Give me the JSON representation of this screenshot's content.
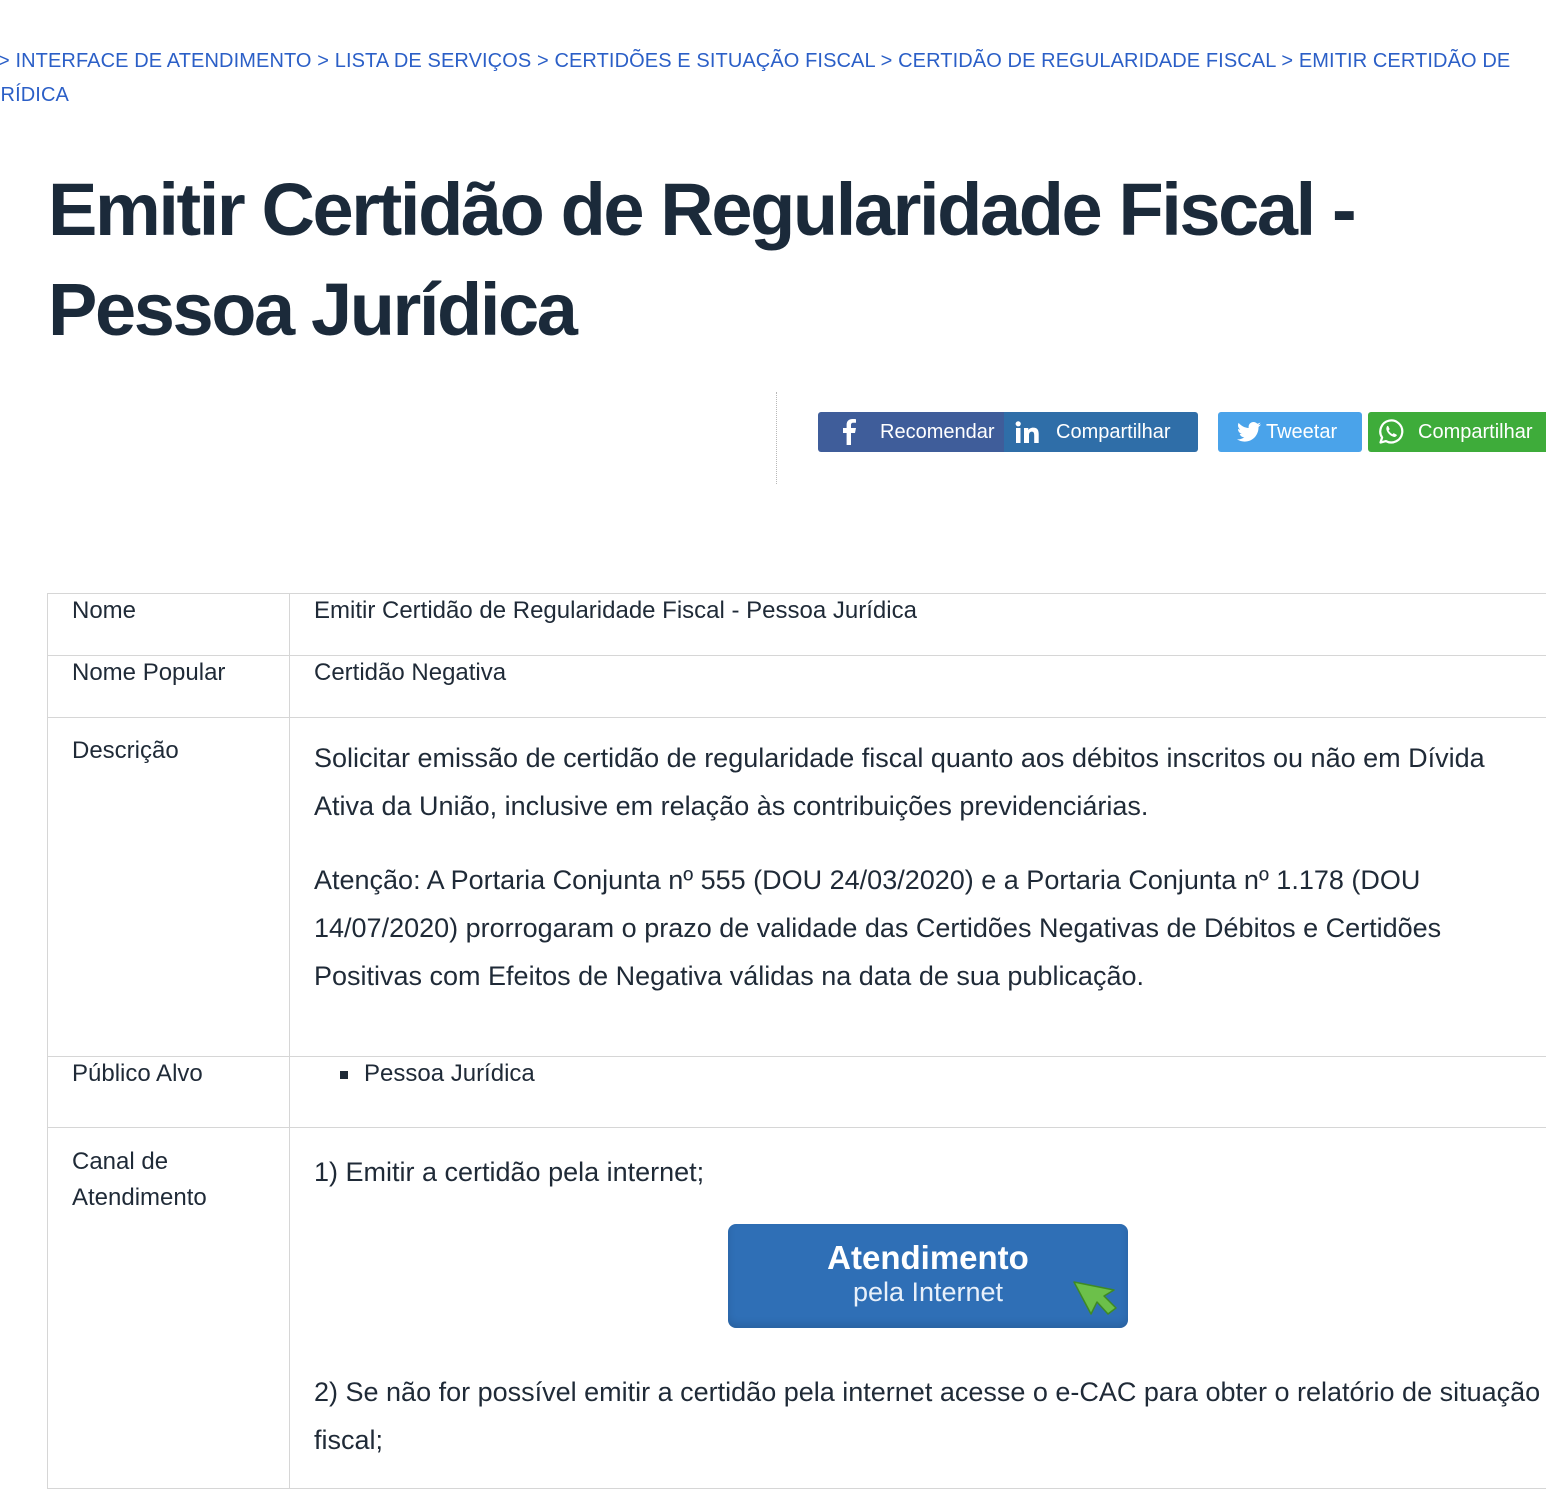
{
  "breadcrumb": {
    "items": [
      "INTERFACE DE ATENDIMENTO",
      "LISTA DE SERVIÇOS",
      "CERTIDÕES E SITUAÇÃO FISCAL",
      "CERTIDÃO DE REGULARIDADE FISCAL",
      "EMITIR CERTIDÃO DE",
      "URÍDICA"
    ],
    "separator": ">"
  },
  "page": {
    "title_line1": "Emitir Certidão de Regularidade Fiscal -",
    "title_line2": "Pessoa Jurídica"
  },
  "share": {
    "facebook": {
      "label": "Recomendar",
      "icon": "facebook-icon",
      "color": "#3f5d9a"
    },
    "linkedin": {
      "label": "Compartilhar",
      "icon": "linkedin-icon",
      "color": "#2f6ea8"
    },
    "twitter": {
      "label": "Tweetar",
      "icon": "twitter-icon",
      "color": "#4aa3ea"
    },
    "whatsapp": {
      "label": "Compartilhar",
      "icon": "whatsapp-icon",
      "color": "#3eac3a"
    }
  },
  "table": {
    "nome": {
      "label": "Nome",
      "value": "Emitir Certidão de Regularidade Fiscal - Pessoa Jurídica"
    },
    "nome_popular": {
      "label": "Nome Popular",
      "value": "Certidão Negativa"
    },
    "descricao": {
      "label": "Descrição",
      "paragraph1": "Solicitar emissão de certidão de regularidade fiscal quanto aos débitos inscritos ou não em Dívida Ativa da União, inclusive em relação às contribuições previdenciárias.",
      "attention_label": "Atenção:",
      "paragraph2": " A Portaria Conjunta nº 555 (DOU 24/03/2020) e a Portaria Conjunta nº 1.178 (DOU 14/07/2020) prorrogaram o prazo de validade das Certidões Negativas de Débitos e Certidões Positivas com Efeitos de Negativa válidas na data de sua publicação."
    },
    "publico_alvo": {
      "label": "Público Alvo",
      "items": [
        "Pessoa Jurídica"
      ]
    },
    "canal": {
      "label_line1": "Canal de",
      "label_line2": "Atendimento",
      "step1": "1) Emitir a certidão pela internet;",
      "button_main": "Atendimento",
      "button_sub": "pela Internet",
      "step2": "2) Se não for possível emitir a certidão pela internet acesse o e-CAC para obter o relatório de situação fiscal;"
    }
  }
}
